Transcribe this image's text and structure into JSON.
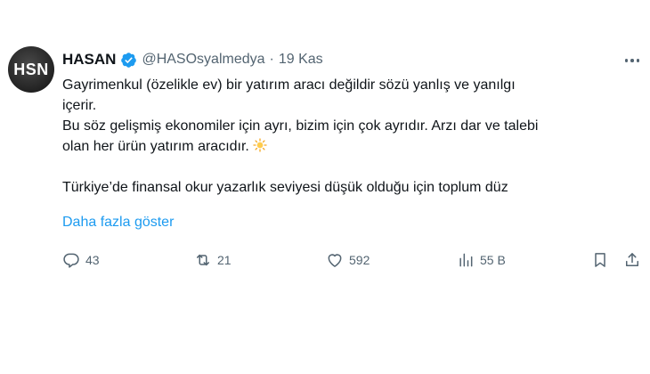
{
  "author": {
    "avatar_text": "HSN",
    "name": "HASAN",
    "handle": "@HASOsyalmedya",
    "separator": "·",
    "date": "19 Kas"
  },
  "tweet": {
    "line1": "Gayrimenkul (özelikle ev) bir yatırım aracı değildir sözü yanlış ve yanılgı",
    "line2": "içerir.",
    "line3": "Bu söz gelişmiş ekonomiler için ayrı, bizim için çok ayrıdır. Arzı dar ve talebi",
    "line4": "olan her ürün yatırım aracıdır.",
    "line5": "Türkiye’de finansal okur yazarlık seviyesi düşük olduğu için toplum düz",
    "show_more": "Daha fazla göster"
  },
  "actions": {
    "replies": "43",
    "reposts": "21",
    "likes": "592",
    "views": "55 B"
  },
  "icons": {
    "verified": "verified-badge-icon",
    "more": "more-dots-icon",
    "reply": "reply-icon",
    "repost": "repost-icon",
    "like": "heart-icon",
    "views": "views-icon",
    "bookmark": "bookmark-icon",
    "share": "share-icon",
    "emoji": "sun-emoji-icon"
  },
  "colors": {
    "accent": "#1d9bf0",
    "text": "#0f1419",
    "muted": "#536471"
  }
}
